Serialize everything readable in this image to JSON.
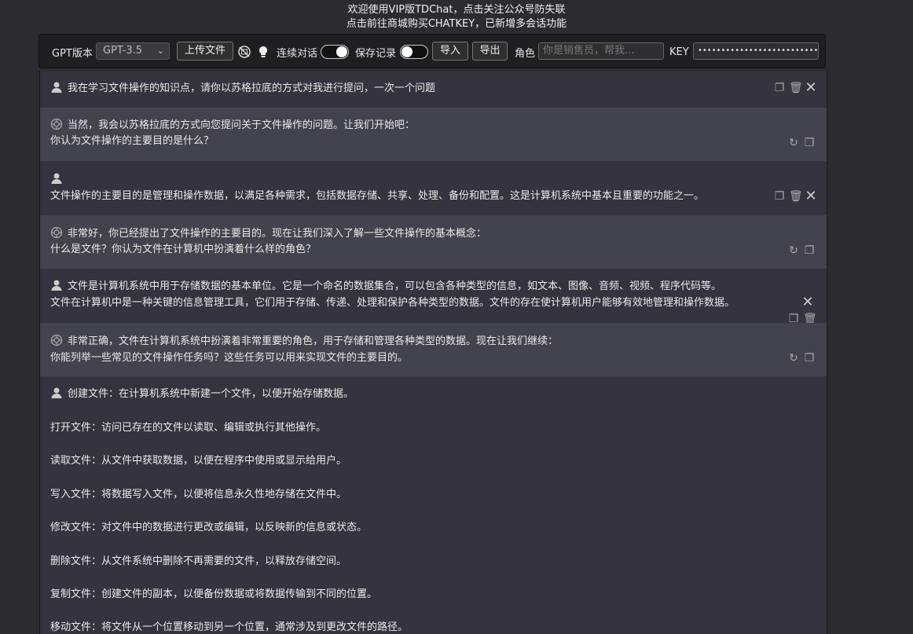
{
  "banner": {
    "line1": "欢迎使用VIP版TDChat，点击关注公众号防失联",
    "line2": "点击前往商城购买CHATKEY，已新增多会话功能"
  },
  "toolbar": {
    "gpt_version_label": "GPT版本",
    "model_selected": "GPT-3.5",
    "upload_label": "上传文件",
    "continuous_label": "连续对话",
    "continuous_on": true,
    "save_label": "保存记录",
    "save_on": false,
    "import_label": "导入",
    "export_label": "导出",
    "role_label": "角色",
    "role_placeholder": "你是销售员，帮我...",
    "key_label": "KEY",
    "key_value": "••••••••••••••••••••••••••••••••••••"
  },
  "messages": [
    {
      "role": "user",
      "lines": [
        "我在学习文件操作的知识点，请你以苏格拉底的方式对我进行提问，一次一个问题"
      ]
    },
    {
      "role": "assistant",
      "lines": [
        "当然，我会以苏格拉底的方式向您提问关于文件操作的问题。让我们开始吧：",
        "你认为文件操作的主要目的是什么？"
      ]
    },
    {
      "role": "user",
      "lines": [
        "",
        "文件操作的主要目的是管理和操作数据，以满足各种需求，包括数据存储、共享、处理、备份和配置。这是计算机系统中基本且重要的功能之一。"
      ]
    },
    {
      "role": "assistant",
      "lines": [
        "非常好，你已经提出了文件操作的主要目的。现在让我们深入了解一些文件操作的基本概念：",
        "什么是文件？你认为文件在计算机中扮演着什么样的角色？"
      ]
    },
    {
      "role": "user",
      "lines": [
        "文件是计算机系统中用于存储数据的基本单位。它是一个命名的数据集合，可以包含各种类型的信息，如文本、图像、音频、视频、程序代码等。",
        "文件在计算机中是一种关键的信息管理工具，它们用于存储、传递、处理和保护各种类型的数据。文件的存在使计算机用户能够有效地管理和操作数据。"
      ]
    },
    {
      "role": "assistant",
      "lines": [
        "非常正确，文件在计算机系统中扮演着非常重要的角色，用于存储和管理各种类型的数据。现在让我们继续：",
        "你能列举一些常见的文件操作任务吗？这些任务可以用来实现文件的主要目的。"
      ]
    },
    {
      "role": "user",
      "lines": [
        "创建文件：在计算机系统中新建一个文件，以便开始存储数据。",
        "打开文件：访问已存在的文件以读取、编辑或执行其他操作。",
        "读取文件：从文件中获取数据，以便在程序中使用或显示给用户。",
        "写入文件：将数据写入文件，以便将信息永久性地存储在文件中。",
        "修改文件：对文件中的数据进行更改或编辑，以反映新的信息或状态。",
        "删除文件：从文件系统中删除不再需要的文件，以释放存储空间。",
        "复制文件：创建文件的副本，以便备份数据或将数据传输到不同的位置。",
        "移动文件：将文件从一个位置移动到另一个位置，通常涉及到更改文件的路径。"
      ]
    }
  ],
  "icons": {
    "user_avatar": "user-avatar-icon",
    "bot_avatar": "openai-logo-icon",
    "copy": "copy-icon",
    "delete": "trash-icon",
    "close": "close-icon",
    "regenerate": "refresh-icon"
  }
}
